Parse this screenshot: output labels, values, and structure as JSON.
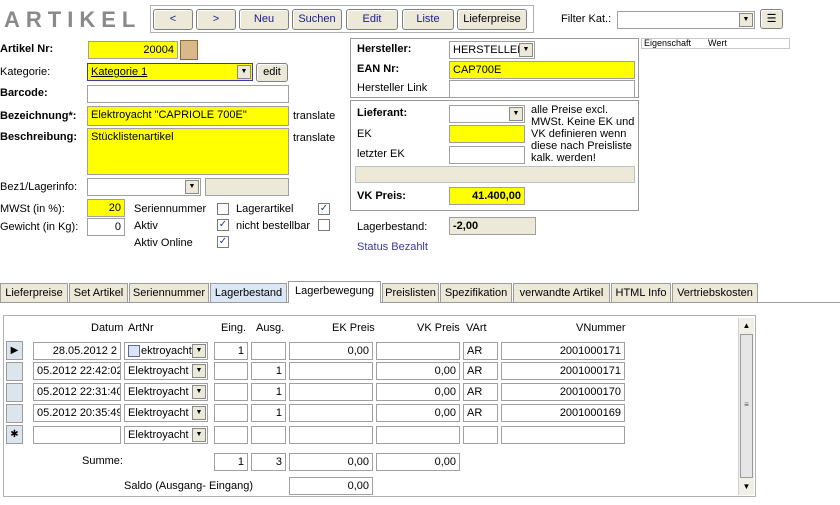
{
  "app": {
    "title": "ARTIKEL"
  },
  "toolbar": {
    "prev_label": "<",
    "next_label": ">",
    "new_label": "Neu",
    "search_label": "Suchen",
    "edit_label": "Edit",
    "list_label": "Liste",
    "supplier_prices_label": "Lieferpreise",
    "filter_label": "Filter Kat.:",
    "filter_value": ""
  },
  "form": {
    "artikel_nr_label": "Artikel Nr:",
    "artikel_nr_value": "20004",
    "kategorie_label": "Kategorie:",
    "kategorie_value": "Kategorie 1",
    "kategorie_edit": "edit",
    "barcode_label": "Barcode:",
    "barcode_value": "",
    "bezeichnung_label": "Bezeichnung*:",
    "bezeichnung_value": "Elektroyacht \"CAPRIOLE 700E\"",
    "translate_label": "translate",
    "beschreibung_label": "Beschreibung:",
    "beschreibung_value": "Stücklistenartikel",
    "bez1_label": "Bez1/Lagerinfo:",
    "bez1_value": "",
    "mwst_label": "MWSt (in %):",
    "mwst_value": "20",
    "gewicht_label": "Gewicht (in Kg):",
    "gewicht_value": "0",
    "seriennummer_label": "Seriennummer",
    "seriennummer_checked": false,
    "aktiv_label": "Aktiv",
    "aktiv_checked": true,
    "aktiv_online_label": "Aktiv Online",
    "aktiv_online_checked": true,
    "lagerartikel_label": "Lagerartikel",
    "lagerartikel_checked": true,
    "nicht_bestellbar_label": "nicht bestellbar",
    "nicht_bestellbar_checked": false
  },
  "hersteller": {
    "hersteller_label": "Hersteller:",
    "hersteller_value": "HERSTELLER",
    "ean_label": "EAN Nr:",
    "ean_value": "CAP700E",
    "link_label": "Hersteller Link",
    "link_value": ""
  },
  "pricing": {
    "lieferant_label": "Lieferant:",
    "lieferant_value": "",
    "note": "alle Preise excl. MWSt.  Keine EK und VK definieren wenn diese nach Preisliste kalk. werden!",
    "ek_label": "EK",
    "ek_value": "",
    "letzter_ek_label": "letzter EK",
    "letzter_ek_value": "",
    "vk_label": "VK Preis:",
    "vk_value": "41.400,00",
    "lagerbestand_label": "Lagerbestand:",
    "lagerbestand_value": "-2,00",
    "status_label": "Status Bezahlt"
  },
  "properties": {
    "col_eigenschaft": "Eigenschaft",
    "col_wert": "Wert"
  },
  "tabs": [
    {
      "label": "Lieferpreise"
    },
    {
      "label": "Set Artikel"
    },
    {
      "label": "Seriennummer"
    },
    {
      "label": "Lagerbestand"
    },
    {
      "label": "Lagerbewegung"
    },
    {
      "label": "Preislisten"
    },
    {
      "label": "Spezifikation"
    },
    {
      "label": "verwandte Artikel"
    },
    {
      "label": "HTML Info"
    },
    {
      "label": "Vertriebskosten"
    }
  ],
  "grid": {
    "headers": {
      "datum": "Datum",
      "artnr": "ArtNr",
      "eing": "Eing.",
      "ausg": "Ausg.",
      "ek": "EK Preis",
      "vk": "VK Preis",
      "vart": "VArt",
      "vnummer": "VNummer"
    },
    "rows": [
      {
        "datum": "28.05.2012 2",
        "artnr": "ektroyacht '",
        "eing": "1",
        "ausg": "",
        "ek": "0,00",
        "vk": "",
        "vart": "AR",
        "vnummer": "2001000171"
      },
      {
        "datum": "05.2012 22:42:02",
        "artnr": "Elektroyacht '",
        "eing": "",
        "ausg": "1",
        "ek": "",
        "vk": "0,00",
        "vart": "AR",
        "vnummer": "2001000171"
      },
      {
        "datum": "05.2012 22:31:40",
        "artnr": "Elektroyacht '",
        "eing": "",
        "ausg": "1",
        "ek": "",
        "vk": "0,00",
        "vart": "AR",
        "vnummer": "2001000170"
      },
      {
        "datum": "05.2012 20:35:49",
        "artnr": "Elektroyacht '",
        "eing": "",
        "ausg": "1",
        "ek": "",
        "vk": "0,00",
        "vart": "AR",
        "vnummer": "2001000169"
      },
      {
        "datum": "",
        "artnr": "Elektroyacht '",
        "eing": "",
        "ausg": "",
        "ek": "",
        "vk": "",
        "vart": "",
        "vnummer": ""
      }
    ],
    "summe_label": "Summe:",
    "summe_eing": "1",
    "summe_ausg": "3",
    "summe_ek": "0,00",
    "summe_vk": "0,00",
    "saldo_label": "Saldo (Ausgang- Eingang)",
    "saldo_value": "0,00"
  },
  "colors": {
    "yellow": "#ffff00",
    "link_blue": "#3a3a9a",
    "tab_highlight": "#dbe7f5"
  }
}
